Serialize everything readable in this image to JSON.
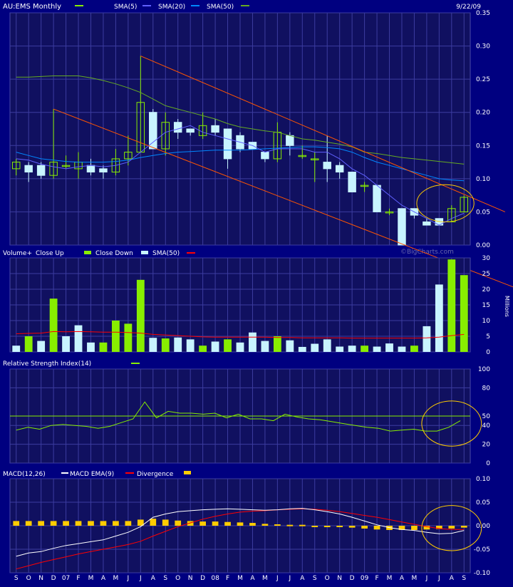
{
  "colors": {
    "background": "#000080",
    "plot_bg": "#101060",
    "grid": "#3c3ca0",
    "text": "#ffffff",
    "up": "#88ee00",
    "down": "#c8f4ff",
    "sma5": "#0088ff",
    "sma20": "#6060ff",
    "sma50": "#66aa22",
    "trend": "#ff5500",
    "circle": "#ffcc00",
    "vol_sma": "#ff0000",
    "rsi": "#88ee00",
    "macd": "#ffffff",
    "macd_ema": "#ff0000",
    "divergence": "#ffcc00"
  },
  "header": {
    "title": "AU:EMS Monthly",
    "date": "9/22/09",
    "sma5": "SMA(5)",
    "sma20": "SMA(20)",
    "sma50": "SMA(50)"
  },
  "months": [
    "S",
    "O",
    "N",
    "D",
    "07",
    "F",
    "M",
    "A",
    "M",
    "J",
    "J",
    "A",
    "S",
    "O",
    "N",
    "D",
    "08",
    "F",
    "M",
    "A",
    "M",
    "J",
    "J",
    "A",
    "S",
    "O",
    "N",
    "D",
    "09",
    "F",
    "M",
    "A",
    "M",
    "J",
    "J",
    "A",
    "S"
  ],
  "chart_data": [
    {
      "type": "candlestick",
      "title": "AU:EMS Monthly",
      "ylim": [
        0,
        0.35
      ],
      "yticks": [
        "0.00",
        "0.05",
        "0.10",
        "0.15",
        "0.20",
        "0.25",
        "0.30",
        "0.35"
      ],
      "candles": [
        {
          "o": 0.115,
          "h": 0.13,
          "l": 0.105,
          "c": 0.125
        },
        {
          "o": 0.12,
          "h": 0.125,
          "l": 0.095,
          "c": 0.11
        },
        {
          "o": 0.12,
          "h": 0.125,
          "l": 0.1,
          "c": 0.105
        },
        {
          "o": 0.105,
          "h": 0.205,
          "l": 0.1,
          "c": 0.125
        },
        {
          "o": 0.12,
          "h": 0.135,
          "l": 0.115,
          "c": 0.12
        },
        {
          "o": 0.115,
          "h": 0.14,
          "l": 0.1,
          "c": 0.125
        },
        {
          "o": 0.12,
          "h": 0.13,
          "l": 0.105,
          "c": 0.11
        },
        {
          "o": 0.115,
          "h": 0.12,
          "l": 0.1,
          "c": 0.11
        },
        {
          "o": 0.11,
          "h": 0.145,
          "l": 0.105,
          "c": 0.13
        },
        {
          "o": 0.13,
          "h": 0.165,
          "l": 0.12,
          "c": 0.14
        },
        {
          "o": 0.14,
          "h": 0.285,
          "l": 0.14,
          "c": 0.215
        },
        {
          "o": 0.2,
          "h": 0.205,
          "l": 0.145,
          "c": 0.145
        },
        {
          "o": 0.145,
          "h": 0.2,
          "l": 0.135,
          "c": 0.185
        },
        {
          "o": 0.185,
          "h": 0.19,
          "l": 0.16,
          "c": 0.17
        },
        {
          "o": 0.175,
          "h": 0.175,
          "l": 0.165,
          "c": 0.17
        },
        {
          "o": 0.165,
          "h": 0.2,
          "l": 0.16,
          "c": 0.18
        },
        {
          "o": 0.18,
          "h": 0.19,
          "l": 0.165,
          "c": 0.17
        },
        {
          "o": 0.175,
          "h": 0.175,
          "l": 0.115,
          "c": 0.13
        },
        {
          "o": 0.165,
          "h": 0.17,
          "l": 0.14,
          "c": 0.145
        },
        {
          "o": 0.155,
          "h": 0.155,
          "l": 0.145,
          "c": 0.145
        },
        {
          "o": 0.14,
          "h": 0.14,
          "l": 0.125,
          "c": 0.13
        },
        {
          "o": 0.13,
          "h": 0.185,
          "l": 0.125,
          "c": 0.17
        },
        {
          "o": 0.165,
          "h": 0.17,
          "l": 0.135,
          "c": 0.15
        },
        {
          "o": 0.135,
          "h": 0.15,
          "l": 0.13,
          "c": 0.135
        },
        {
          "o": 0.13,
          "h": 0.14,
          "l": 0.095,
          "c": 0.13
        },
        {
          "o": 0.125,
          "h": 0.165,
          "l": 0.095,
          "c": 0.115
        },
        {
          "o": 0.12,
          "h": 0.125,
          "l": 0.1,
          "c": 0.11
        },
        {
          "o": 0.11,
          "h": 0.11,
          "l": 0.08,
          "c": 0.08
        },
        {
          "o": 0.09,
          "h": 0.095,
          "l": 0.08,
          "c": 0.09
        },
        {
          "o": 0.09,
          "h": 0.09,
          "l": 0.05,
          "c": 0.05
        },
        {
          "o": 0.05,
          "h": 0.055,
          "l": 0.045,
          "c": 0.05
        },
        {
          "o": 0.055,
          "h": 0.055,
          "l": 0,
          "c": 0
        },
        {
          "o": 0.055,
          "h": 0.055,
          "l": 0.04,
          "c": 0.045
        },
        {
          "o": 0.035,
          "h": 0.04,
          "l": 0.03,
          "c": 0.03
        },
        {
          "o": 0.04,
          "h": 0.04,
          "l": 0.03,
          "c": 0.03
        },
        {
          "o": 0.035,
          "h": 0.06,
          "l": 0.035,
          "c": 0.055
        },
        {
          "o": 0.05,
          "h": 0.075,
          "l": 0.05,
          "c": 0.072
        }
      ],
      "sma5": [
        0.13,
        0.128,
        0.122,
        0.118,
        0.115,
        0.118,
        0.12,
        0.118,
        0.12,
        0.125,
        0.14,
        0.155,
        0.17,
        0.175,
        0.18,
        0.17,
        0.165,
        0.16,
        0.155,
        0.15,
        0.14,
        0.145,
        0.145,
        0.145,
        0.14,
        0.14,
        0.13,
        0.115,
        0.105,
        0.09,
        0.075,
        0.06,
        0.05,
        0.04,
        0.03,
        0.04,
        0.048
      ],
      "sma20": [
        0.14,
        0.135,
        0.13,
        0.128,
        0.126,
        0.125,
        0.125,
        0.125,
        0.126,
        0.128,
        0.132,
        0.135,
        0.138,
        0.14,
        0.141,
        0.142,
        0.143,
        0.143,
        0.143,
        0.144,
        0.145,
        0.146,
        0.147,
        0.148,
        0.148,
        0.147,
        0.145,
        0.14,
        0.132,
        0.125,
        0.12,
        0.115,
        0.11,
        0.105,
        0.1,
        0.098,
        0.097
      ],
      "sma50": [
        0.253,
        0.253,
        0.254,
        0.255,
        0.255,
        0.255,
        0.252,
        0.248,
        0.243,
        0.237,
        0.23,
        0.22,
        0.21,
        0.205,
        0.2,
        0.195,
        0.19,
        0.183,
        0.178,
        0.175,
        0.172,
        0.17,
        0.165,
        0.16,
        0.158,
        0.155,
        0.152,
        0.148,
        0.14,
        0.138,
        0.135,
        0.132,
        0.13,
        0.128,
        0.126,
        0.124,
        0.122
      ],
      "trend_lines": [
        {
          "x1": 10,
          "y1": 0.285,
          "x2": 39.3,
          "y2": 0.05
        },
        {
          "x1": 3,
          "y1": 0.205,
          "x2": 40.2,
          "y2": -0.065
        }
      ],
      "highlight_circle": {
        "x": 34.5,
        "y": 0.063,
        "rx": 2.3,
        "ry": 0.028
      }
    },
    {
      "type": "bar",
      "title": "Volume+",
      "legend": [
        "Close Up",
        "Close Down",
        "SMA(50)"
      ],
      "ylabel": "Millions",
      "ylim": [
        0,
        30
      ],
      "yticks": [
        "0",
        "5",
        "10",
        "15",
        "20",
        "25",
        "30"
      ],
      "values": [
        2,
        5,
        3.5,
        17,
        5,
        8.5,
        3,
        3,
        10,
        9,
        23,
        4.5,
        4.3,
        4.6,
        4,
        2,
        3.3,
        4,
        3,
        6.2,
        3.5,
        5,
        3.7,
        1.6,
        2.6,
        4,
        1.7,
        2,
        2,
        1.7,
        2.7,
        1.7,
        2,
        8.2,
        21.5,
        29.5,
        24.5
      ],
      "up": [
        false,
        true,
        false,
        true,
        false,
        false,
        false,
        true,
        true,
        true,
        true,
        false,
        true,
        false,
        false,
        true,
        false,
        true,
        false,
        false,
        false,
        true,
        false,
        false,
        false,
        false,
        false,
        false,
        true,
        false,
        false,
        false,
        true,
        false,
        false,
        true,
        true
      ],
      "sma50": [
        5.8,
        5.9,
        6.0,
        6.5,
        6.4,
        6.5,
        6.4,
        6.3,
        6.3,
        6.2,
        6.0,
        5.6,
        5.4,
        5.2,
        5.0,
        4.8,
        4.7,
        4.7,
        4.7,
        4.7,
        4.7,
        4.6,
        4.6,
        4.5,
        4.5,
        4.5,
        4.5,
        4.4,
        4.4,
        4.4,
        4.4,
        4.4,
        4.4,
        4.5,
        4.7,
        5.2,
        5.6
      ]
    },
    {
      "type": "line",
      "title": "Relative Strength Index(14)",
      "ylim": [
        0,
        100
      ],
      "yticks": [
        "0",
        "20",
        "40",
        "50",
        "80",
        "100"
      ],
      "reference": 50,
      "values": [
        35,
        38,
        36,
        40,
        41,
        40,
        39,
        37,
        39,
        43,
        47,
        65,
        48,
        55,
        53,
        53,
        52,
        53,
        48,
        52,
        47,
        47,
        45,
        52,
        49,
        47,
        46,
        44,
        42,
        40,
        38,
        37,
        34,
        35,
        36,
        34,
        34,
        38,
        45
      ],
      "highlight_circle": {
        "x": 35,
        "y": 42,
        "rx": 2.4,
        "ry": 24
      }
    },
    {
      "type": "line",
      "title": "MACD(12,26)",
      "legend": [
        "MACD EMA(9)",
        "Divergence"
      ],
      "ylim": [
        -0.1,
        0.1
      ],
      "yticks": [
        "-0.10",
        "-0.05",
        "0.00",
        "0.05",
        "0.10"
      ],
      "macd": [
        -0.065,
        -0.058,
        -0.055,
        -0.048,
        -0.042,
        -0.038,
        -0.034,
        -0.03,
        -0.022,
        -0.014,
        -0.002,
        0.018,
        0.025,
        0.03,
        0.032,
        0.034,
        0.035,
        0.036,
        0.035,
        0.034,
        0.033,
        0.034,
        0.036,
        0.037,
        0.034,
        0.03,
        0.025,
        0.018,
        0.01,
        0.002,
        -0.004,
        -0.008,
        -0.01,
        -0.014,
        -0.017,
        -0.016,
        -0.01
      ],
      "ema": [
        -0.092,
        -0.085,
        -0.078,
        -0.072,
        -0.066,
        -0.06,
        -0.055,
        -0.05,
        -0.045,
        -0.04,
        -0.033,
        -0.022,
        -0.012,
        -0.002,
        0.006,
        0.014,
        0.02,
        0.025,
        0.029,
        0.031,
        0.032,
        0.034,
        0.035,
        0.036,
        0.035,
        0.033,
        0.03,
        0.026,
        0.022,
        0.018,
        0.013,
        0.008,
        0.003,
        -0.002,
        -0.006,
        -0.008,
        -0.008
      ],
      "divergence": [
        0.01,
        0.01,
        0.01,
        0.01,
        0.01,
        0.01,
        0.01,
        0.01,
        0.01,
        0.01,
        0.013,
        0.015,
        0.013,
        0.011,
        0.01,
        0.009,
        0.009,
        0.008,
        0.007,
        0.006,
        0.004,
        0.003,
        0.002,
        0.002,
        0.0,
        -0.002,
        -0.003,
        -0.004,
        -0.006,
        -0.008,
        -0.009,
        -0.009,
        -0.009,
        -0.008,
        -0.007,
        -0.006,
        -0.004
      ],
      "highlight_circle": {
        "x": 35,
        "y": -0.005,
        "rx": 2.4,
        "ry": 0.048
      }
    }
  ],
  "volume_header": {
    "title": "Volume+",
    "close_up": "Close Up",
    "close_down": "Close Down",
    "sma50": "SMA(50)",
    "unit": "Millions",
    "watermark": "©BigCharts.com"
  },
  "rsi_header": {
    "title": "Relative Strength Index(14)"
  },
  "macd_header": {
    "title": "MACD(12,26)",
    "ema": "MACD EMA(9)",
    "divergence": "Divergence"
  }
}
